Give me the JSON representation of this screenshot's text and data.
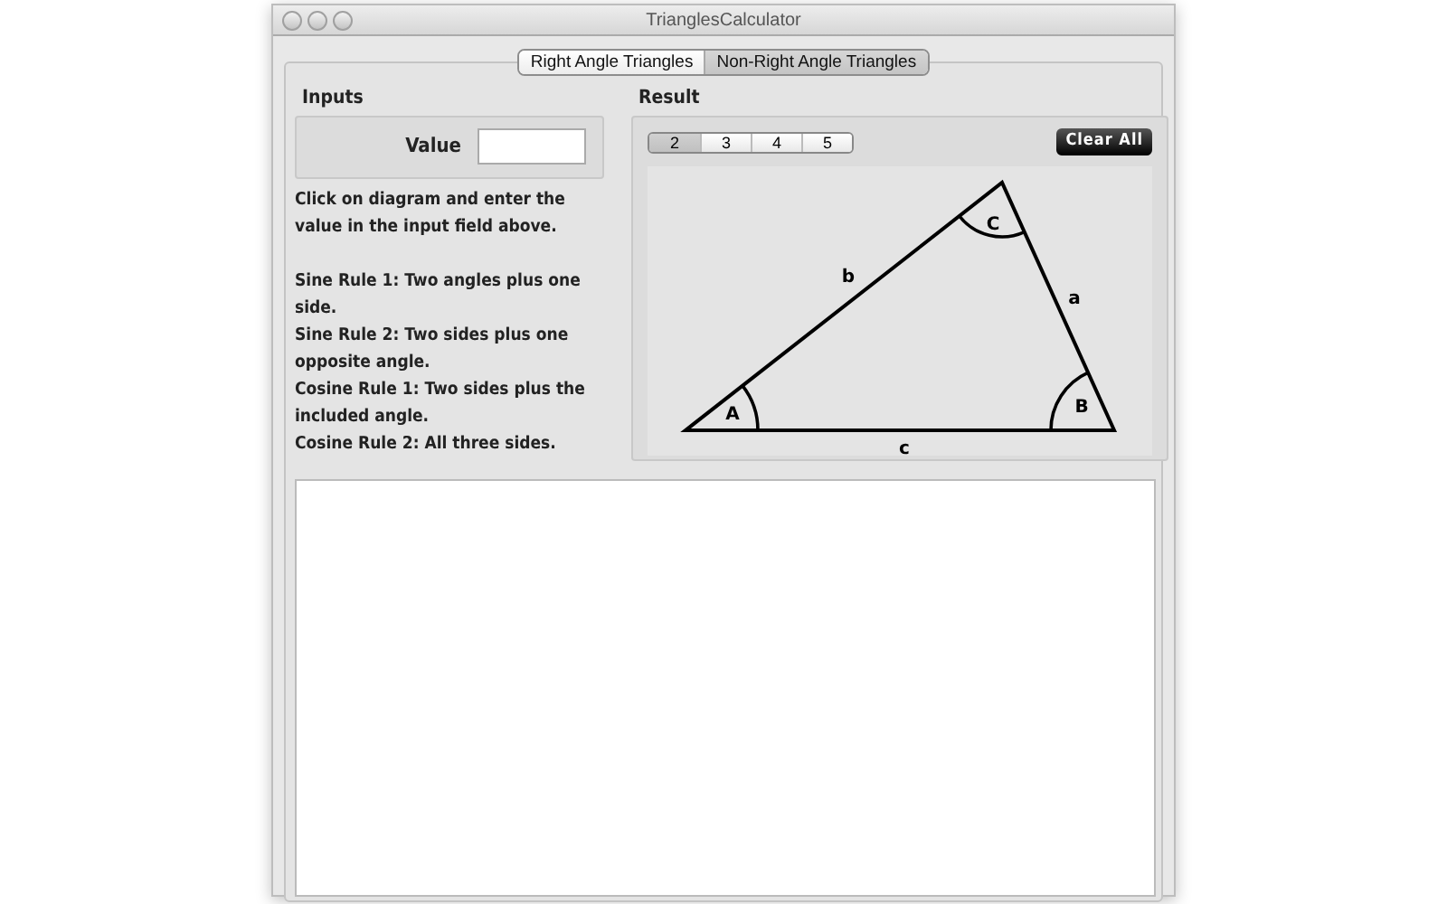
{
  "window": {
    "title": "TrianglesCalculator"
  },
  "tabs": [
    {
      "label": "Right Angle Triangles",
      "selected": false
    },
    {
      "label": "Non-Right Angle Triangles",
      "selected": true
    }
  ],
  "inputs": {
    "title": "Inputs",
    "value_label": "Value"
  },
  "instructions": [
    "Click on diagram and enter the value in the input field above.",
    "Sine Rule 1: Two angles plus one side.",
    "Sine Rule 2: Two sides plus one opposite angle.",
    "Cosine Rule 1: Two sides plus the included angle.",
    "Cosine Rule 2: All three sides."
  ],
  "result": {
    "title": "Result",
    "segments": [
      {
        "label": "2",
        "selected": true
      },
      {
        "label": "3",
        "selected": false
      },
      {
        "label": "4",
        "selected": false
      },
      {
        "label": "5",
        "selected": false
      }
    ],
    "clear_button": "Clear All"
  },
  "diagram": {
    "side_b": "b",
    "side_a": "a",
    "side_c": "c",
    "angle_a": "A",
    "angle_b": "B",
    "angle_c": "C"
  }
}
